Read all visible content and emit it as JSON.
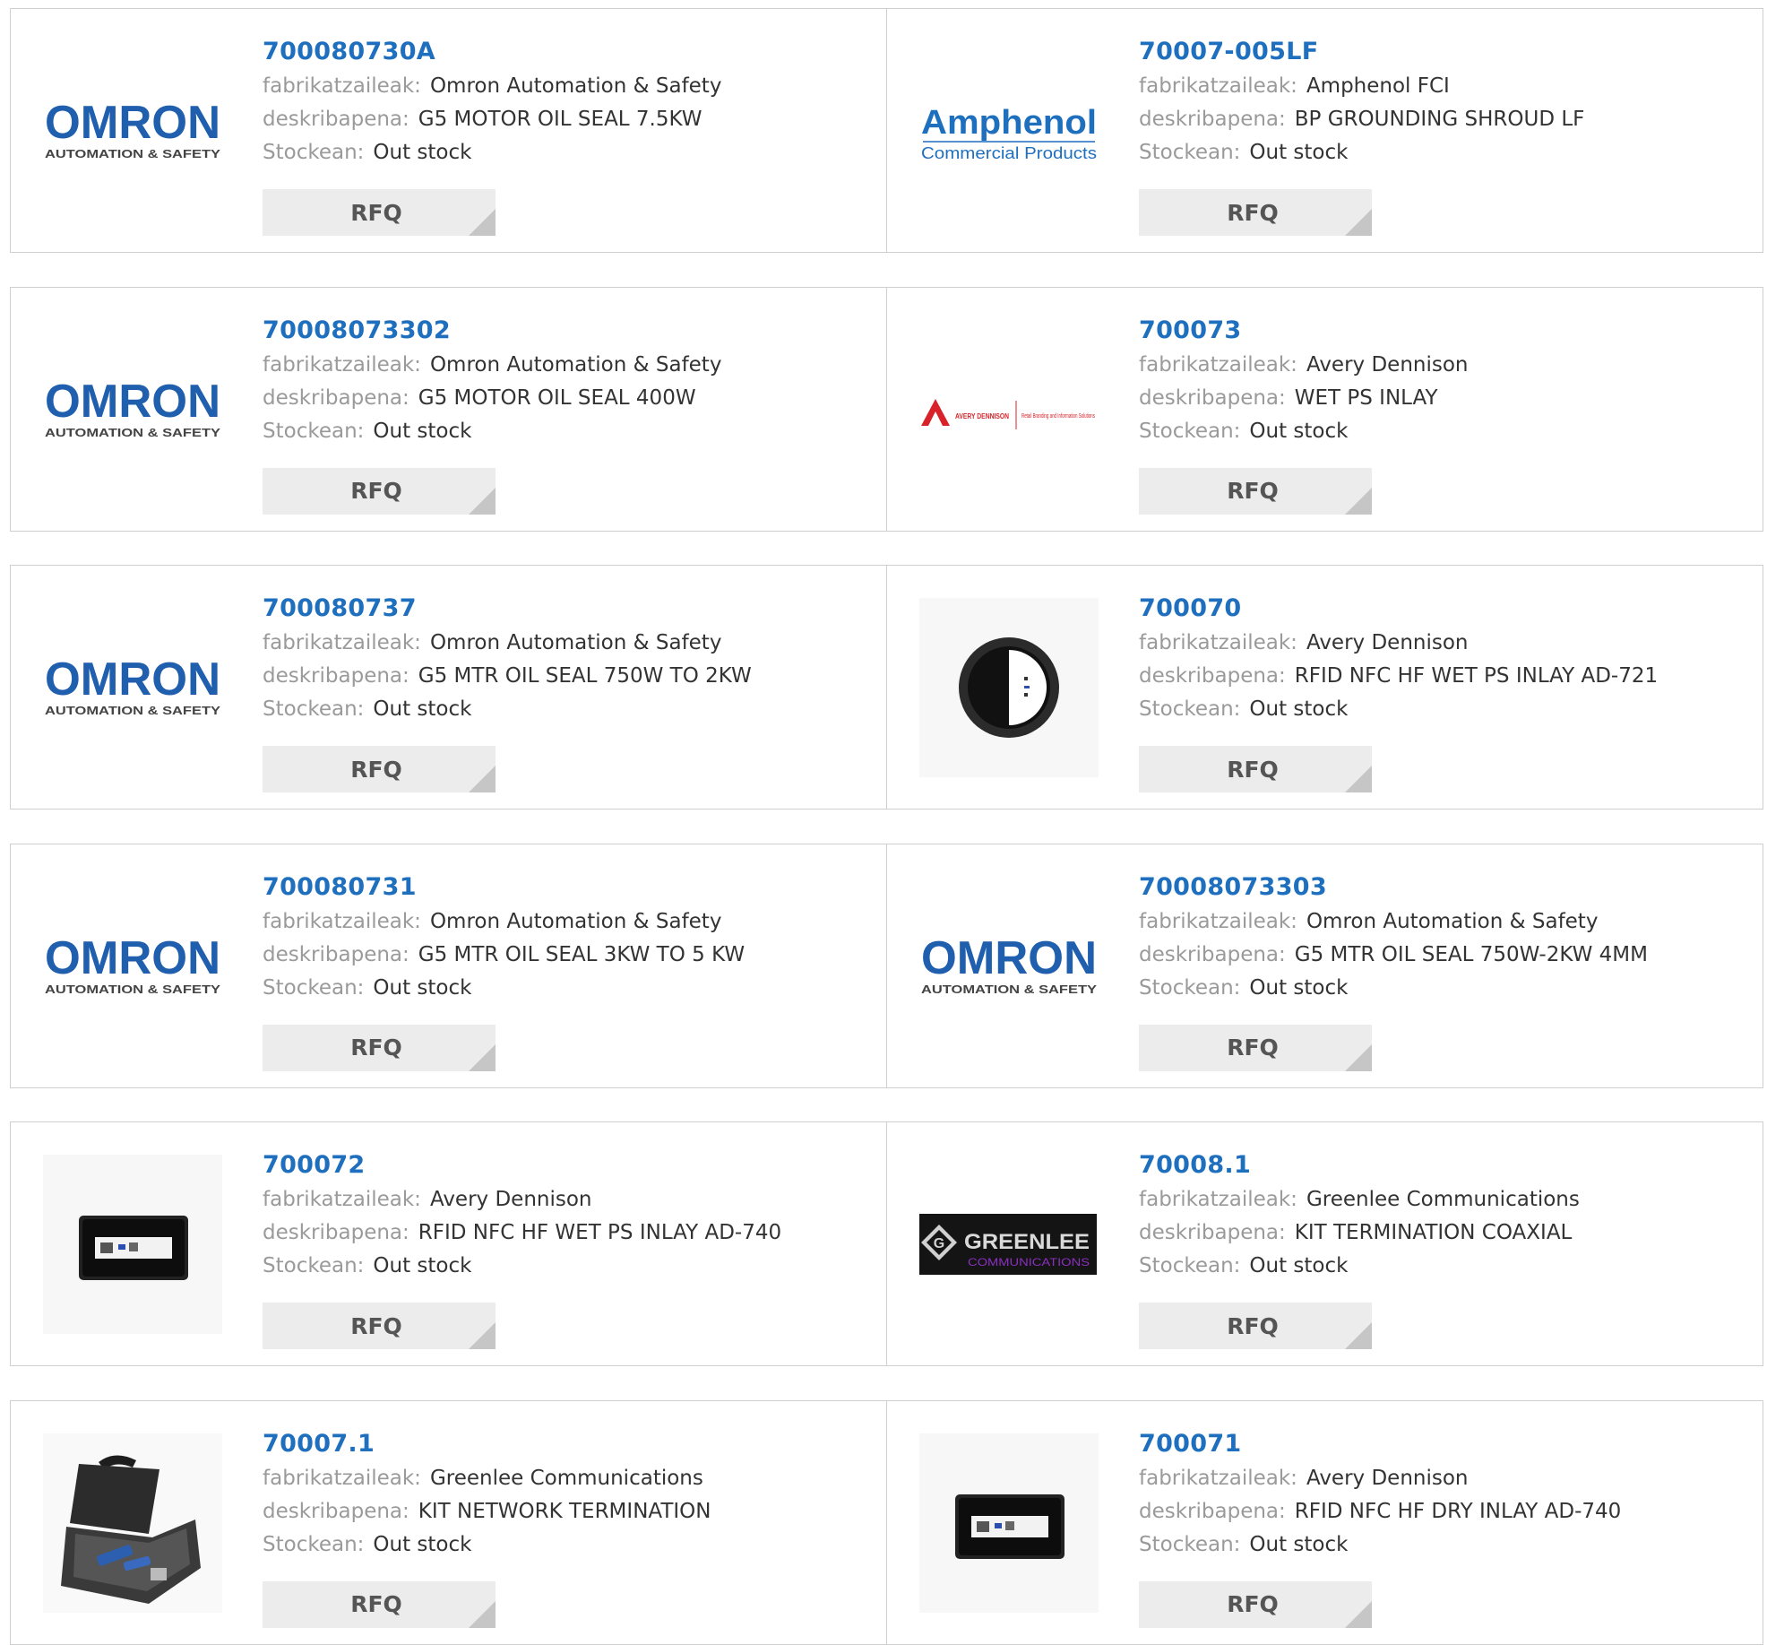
{
  "labels": {
    "manufacturer": "fabrikatzaileak:",
    "description": "deskribapena:",
    "stock": "Stockean:",
    "rfq": "RFQ"
  },
  "colors": {
    "link": "#1f6fbf",
    "omron_blue": "#1f5fae",
    "amphenol_blue": "#1f6fbf"
  },
  "products": [
    {
      "part": "700080730A",
      "manufacturer": "Omron Automation & Safety",
      "description": "G5 MOTOR OIL SEAL 7.5KW",
      "stock": "Out stock",
      "logo": "omron-logo",
      "logo_text": "OMRON",
      "logo_sub": "AUTOMATION & SAFETY"
    },
    {
      "part": "70007-005LF",
      "manufacturer": "Amphenol FCI",
      "description": "BP GROUNDING SHROUD LF",
      "stock": "Out stock",
      "logo": "amphenol-logo",
      "logo_text": "Amphenol",
      "logo_sub": "Commercial Products"
    },
    {
      "part": "70008073302",
      "manufacturer": "Omron Automation & Safety",
      "description": "G5 MOTOR OIL SEAL 400W",
      "stock": "Out stock",
      "logo": "omron-logo",
      "logo_text": "OMRON",
      "logo_sub": "AUTOMATION & SAFETY"
    },
    {
      "part": "700073",
      "manufacturer": "Avery Dennison",
      "description": "WET PS INLAY",
      "stock": "Out stock",
      "logo": "avery-dennison-logo",
      "logo_text": "AVERY DENNISON",
      "logo_sub": "Retail Branding and Information Solutions"
    },
    {
      "part": "700080737",
      "manufacturer": "Omron Automation & Safety",
      "description": "G5 MTR OIL SEAL 750W TO 2KW",
      "stock": "Out stock",
      "logo": "omron-logo",
      "logo_text": "OMRON",
      "logo_sub": "AUTOMATION & SAFETY"
    },
    {
      "part": "700070",
      "manufacturer": "Avery Dennison",
      "description": "RFID NFC HF WET PS INLAY AD-721",
      "stock": "Out stock",
      "logo": "round-rfid-tag-image",
      "logo_text": "",
      "logo_sub": ""
    },
    {
      "part": "700080731",
      "manufacturer": "Omron Automation & Safety",
      "description": "G5 MTR OIL SEAL 3KW TO 5 KW",
      "stock": "Out stock",
      "logo": "omron-logo",
      "logo_text": "OMRON",
      "logo_sub": "AUTOMATION & SAFETY"
    },
    {
      "part": "70008073303",
      "manufacturer": "Omron Automation & Safety",
      "description": "G5 MTR OIL SEAL 750W-2KW 4MM",
      "stock": "Out stock",
      "logo": "omron-logo",
      "logo_text": "OMRON",
      "logo_sub": "AUTOMATION & SAFETY"
    },
    {
      "part": "700072",
      "manufacturer": "Avery Dennison",
      "description": "RFID NFC HF WET PS INLAY AD-740",
      "stock": "Out stock",
      "logo": "rect-rfid-inlay-image",
      "logo_text": "",
      "logo_sub": ""
    },
    {
      "part": "70008.1",
      "manufacturer": "Greenlee Communications",
      "description": "KIT TERMINATION COAXIAL",
      "stock": "Out stock",
      "logo": "greenlee-logo",
      "logo_text": "GREENLEE",
      "logo_sub": "COMMUNICATIONS"
    },
    {
      "part": "70007.1",
      "manufacturer": "Greenlee Communications",
      "description": "KIT NETWORK TERMINATION",
      "stock": "Out stock",
      "logo": "tool-case-image",
      "logo_text": "",
      "logo_sub": ""
    },
    {
      "part": "700071",
      "manufacturer": "Avery Dennison",
      "description": "RFID NFC HF DRY INLAY AD-740",
      "stock": "Out stock",
      "logo": "rect-rfid-inlay-image",
      "logo_text": "",
      "logo_sub": ""
    }
  ]
}
